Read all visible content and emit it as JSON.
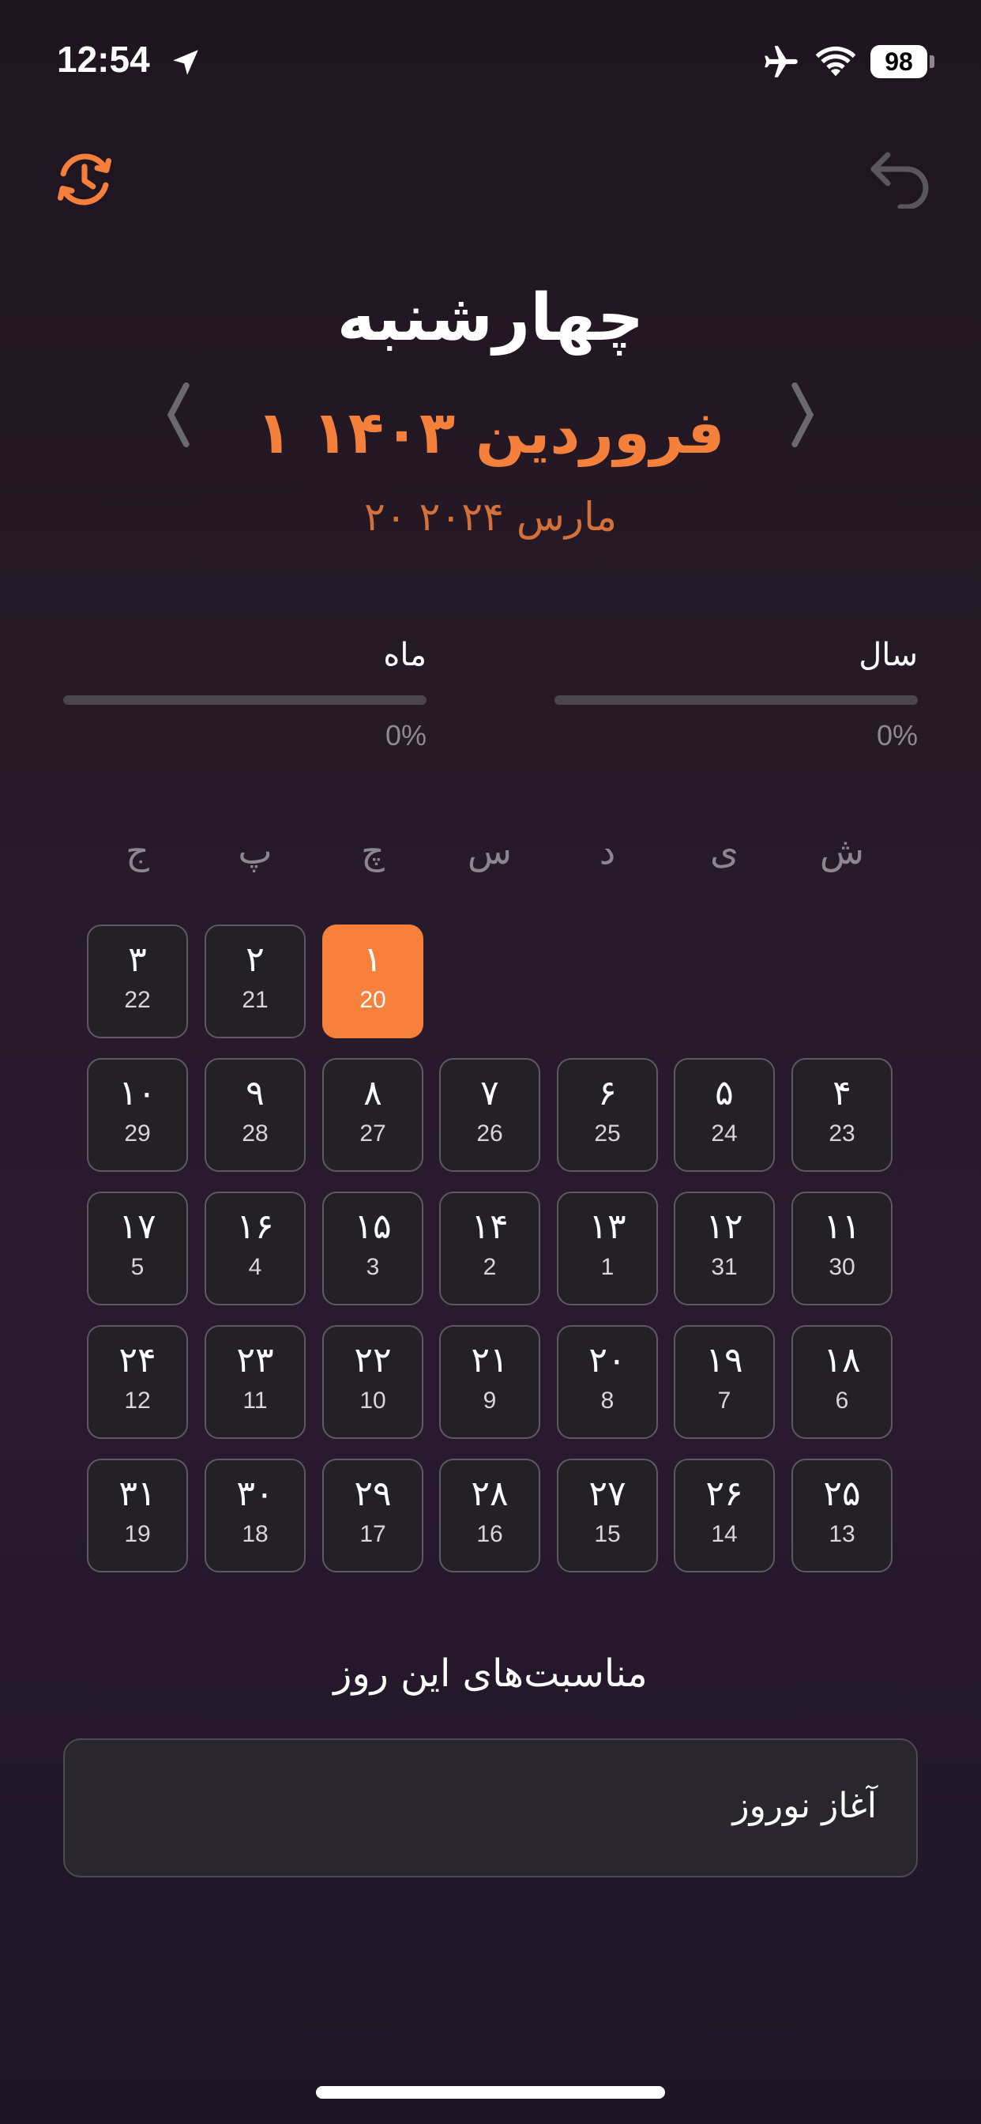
{
  "status_bar": {
    "time": "12:54",
    "battery": "98",
    "icons": [
      "location-arrow-icon",
      "airplane-icon",
      "wifi-icon",
      "battery-icon"
    ]
  },
  "toolbar": {
    "history_icon": "history-clock-icon",
    "undo_icon": "undo-icon"
  },
  "header": {
    "weekday": "چهارشنبه",
    "jalali_date": "۱ فروردین ۱۴۰۳",
    "gregorian_date": "۲۰ مارس ۲۰۲۴",
    "prev_icon": "chevron-left-icon",
    "next_icon": "chevron-right-icon"
  },
  "progress": {
    "year": {
      "label": "سال",
      "percent_text": "0%",
      "value": 0
    },
    "month": {
      "label": "ماه",
      "percent_text": "0%",
      "value": 0
    }
  },
  "calendar": {
    "weekdays": [
      "ش",
      "ی",
      "د",
      "س",
      "چ",
      "پ",
      "ج"
    ],
    "weeks": [
      [
        null,
        null,
        null,
        null,
        {
          "p": "۱",
          "g": "20",
          "selected": true
        },
        {
          "p": "۲",
          "g": "21"
        },
        {
          "p": "۳",
          "g": "22"
        }
      ],
      [
        {
          "p": "۴",
          "g": "23"
        },
        {
          "p": "۵",
          "g": "24"
        },
        {
          "p": "۶",
          "g": "25"
        },
        {
          "p": "۷",
          "g": "26"
        },
        {
          "p": "۸",
          "g": "27"
        },
        {
          "p": "۹",
          "g": "28"
        },
        {
          "p": "۱۰",
          "g": "29"
        }
      ],
      [
        {
          "p": "۱۱",
          "g": "30"
        },
        {
          "p": "۱۲",
          "g": "31"
        },
        {
          "p": "۱۳",
          "g": "1"
        },
        {
          "p": "۱۴",
          "g": "2"
        },
        {
          "p": "۱۵",
          "g": "3"
        },
        {
          "p": "۱۶",
          "g": "4"
        },
        {
          "p": "۱۷",
          "g": "5"
        }
      ],
      [
        {
          "p": "۱۸",
          "g": "6"
        },
        {
          "p": "۱۹",
          "g": "7"
        },
        {
          "p": "۲۰",
          "g": "8"
        },
        {
          "p": "۲۱",
          "g": "9"
        },
        {
          "p": "۲۲",
          "g": "10"
        },
        {
          "p": "۲۳",
          "g": "11"
        },
        {
          "p": "۲۴",
          "g": "12"
        }
      ],
      [
        {
          "p": "۲۵",
          "g": "13"
        },
        {
          "p": "۲۶",
          "g": "14"
        },
        {
          "p": "۲۷",
          "g": "15"
        },
        {
          "p": "۲۸",
          "g": "16"
        },
        {
          "p": "۲۹",
          "g": "17"
        },
        {
          "p": "۳۰",
          "g": "18"
        },
        {
          "p": "۳۱",
          "g": "19"
        }
      ]
    ]
  },
  "events": {
    "title": "مناسبت‌های این روز",
    "items": [
      "آغاز نوروز"
    ]
  },
  "colors": {
    "accent": "#f5803c",
    "background": "#241a26",
    "cell_background": "#232125",
    "cell_border": "#5d5a62"
  }
}
